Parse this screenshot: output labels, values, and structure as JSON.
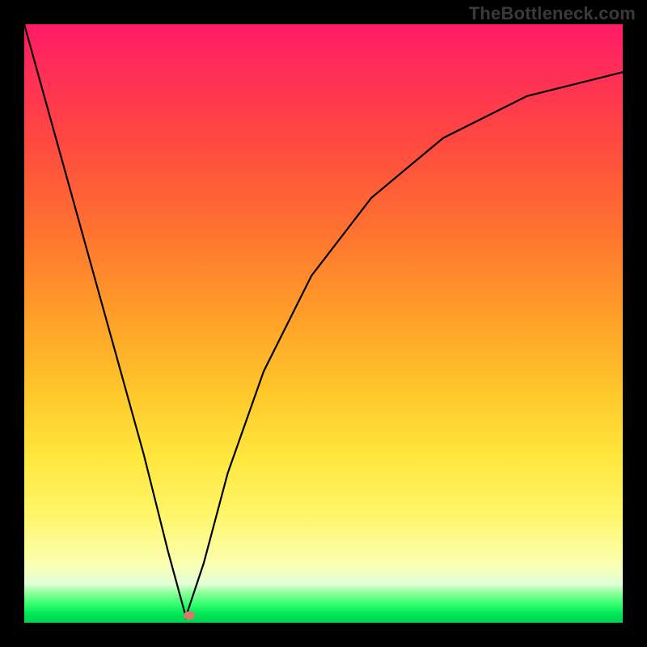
{
  "watermark": "TheBottleneck.com",
  "chart_data": {
    "type": "line",
    "title": "",
    "xlabel": "",
    "ylabel": "",
    "xlim": [
      0,
      100
    ],
    "ylim": [
      0,
      100
    ],
    "grid": false,
    "notes": "V-shaped bottleneck curve over a vertical quality gradient (red at top = bad, green at bottom = good). Minimum of the curve touches the green band near x≈27.",
    "series": [
      {
        "name": "bottleneck-curve",
        "x": [
          0,
          5,
          10,
          15,
          20,
          24,
          27,
          30,
          34,
          40,
          48,
          58,
          70,
          84,
          100
        ],
        "y": [
          100,
          82,
          64,
          46,
          28,
          12,
          1,
          10,
          25,
          42,
          58,
          71,
          81,
          88,
          92
        ]
      }
    ],
    "marker": {
      "x": 27.5,
      "y": 1.2
    },
    "gradient_stops": [
      {
        "pct": 0,
        "color": "#ff1a66"
      },
      {
        "pct": 50,
        "color": "#ffa329"
      },
      {
        "pct": 82,
        "color": "#fff66a"
      },
      {
        "pct": 95,
        "color": "#8cff9a"
      },
      {
        "pct": 100,
        "color": "#00d34e"
      }
    ]
  }
}
